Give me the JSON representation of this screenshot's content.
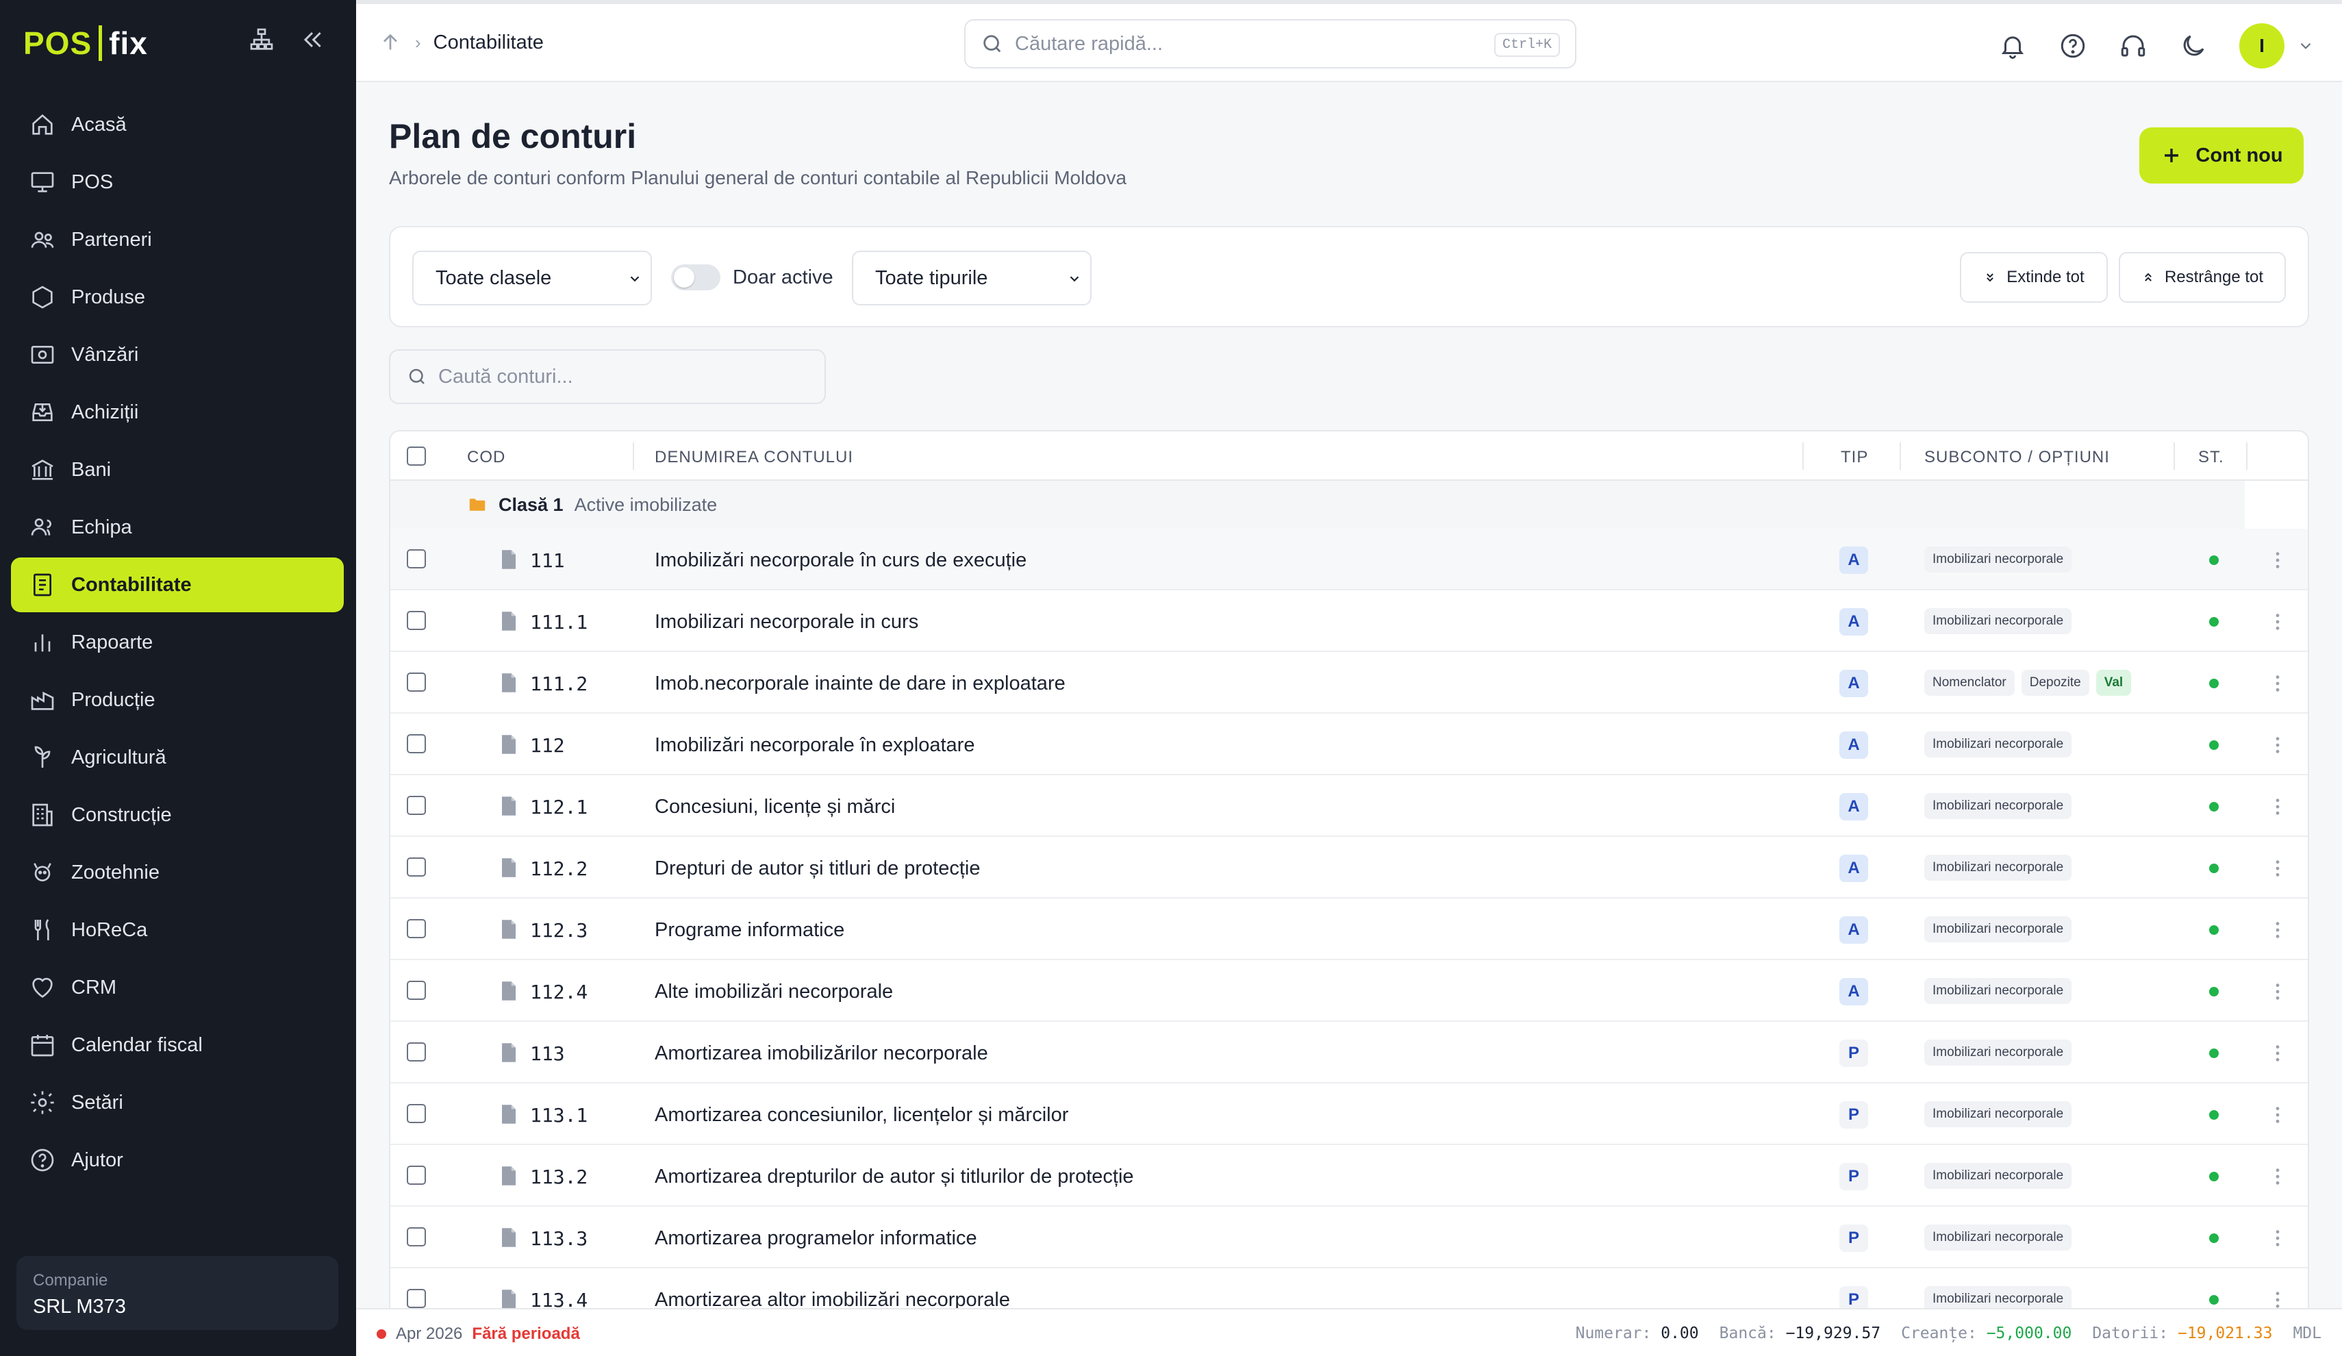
{
  "app": {
    "brand_left": "POS",
    "brand_right": "fix"
  },
  "sidebar": {
    "items": [
      {
        "label": "Acasă",
        "icon": "home-icon"
      },
      {
        "label": "POS",
        "icon": "monitor-icon"
      },
      {
        "label": "Parteneri",
        "icon": "users-icon"
      },
      {
        "label": "Produse",
        "icon": "hexagon-icon"
      },
      {
        "label": "Vânzări",
        "icon": "sales-icon"
      },
      {
        "label": "Achiziții",
        "icon": "inbox-icon"
      },
      {
        "label": "Bani",
        "icon": "bank-icon"
      },
      {
        "label": "Echipa",
        "icon": "team-icon"
      },
      {
        "label": "Contabilitate",
        "icon": "ledger-icon",
        "active": true
      },
      {
        "label": "Rapoarte",
        "icon": "bar-chart-icon"
      },
      {
        "label": "Producție",
        "icon": "factory-icon"
      },
      {
        "label": "Agricultură",
        "icon": "plant-icon"
      },
      {
        "label": "Construcție",
        "icon": "building-icon"
      },
      {
        "label": "Zootehnie",
        "icon": "animal-icon"
      },
      {
        "label": "HoReCa",
        "icon": "fork-knife-icon"
      },
      {
        "label": "CRM",
        "icon": "heart-icon"
      },
      {
        "label": "Calendar fiscal",
        "icon": "calendar-icon"
      },
      {
        "label": "Setări",
        "icon": "gear-icon"
      },
      {
        "label": "Ajutor",
        "icon": "help-icon"
      }
    ],
    "company_label": "Companie",
    "company_name": "SRL M373"
  },
  "topbar": {
    "breadcrumb": "Contabilitate",
    "search_placeholder": "Căutare rapidă...",
    "search_shortcut": "Ctrl+K",
    "avatar_initial": "I"
  },
  "page": {
    "title": "Plan de conturi",
    "subtitle": "Arborele de conturi conform Planului general de conturi contabile al Republicii Moldova",
    "new_button": "Cont nou"
  },
  "filters": {
    "class_select": "Toate clasele",
    "active_toggle_label": "Doar active",
    "type_select": "Toate tipurile",
    "expand_all": "Extinde tot",
    "collapse_all": "Restrânge tot",
    "accounts_search_placeholder": "Caută conturi..."
  },
  "table": {
    "headers": {
      "code": "COD",
      "name": "DENUMIREA CONTULUI",
      "type": "TIP",
      "subconto": "SUBCONTO / OPȚIUNI",
      "status": "ST."
    },
    "group": {
      "class": "Clasă 1",
      "name": "Active imobilizate"
    },
    "rows": [
      {
        "code": "111",
        "name": "Imobilizări necorporale în curs de execuție",
        "type": "A",
        "tags": [
          "Imobilizari necorporale"
        ]
      },
      {
        "code": "111.1",
        "name": "Imobilizari necorporale in curs",
        "type": "A",
        "tags": [
          "Imobilizari necorporale"
        ]
      },
      {
        "code": "111.2",
        "name": "Imob.necorporale inainte de dare in exploatare",
        "type": "A",
        "tags": [
          "Nomenclator",
          "Depozite",
          "Val"
        ]
      },
      {
        "code": "112",
        "name": "Imobilizări necorporale în exploatare",
        "type": "A",
        "tags": [
          "Imobilizari necorporale"
        ]
      },
      {
        "code": "112.1",
        "name": "Concesiuni, licențe și mărci",
        "type": "A",
        "tags": [
          "Imobilizari necorporale"
        ]
      },
      {
        "code": "112.2",
        "name": "Drepturi de autor și titluri de protecție",
        "type": "A",
        "tags": [
          "Imobilizari necorporale"
        ]
      },
      {
        "code": "112.3",
        "name": "Programe informatice",
        "type": "A",
        "tags": [
          "Imobilizari necorporale"
        ]
      },
      {
        "code": "112.4",
        "name": "Alte imobilizări necorporale",
        "type": "A",
        "tags": [
          "Imobilizari necorporale"
        ]
      },
      {
        "code": "113",
        "name": "Amortizarea imobilizărilor necorporale",
        "type": "P",
        "tags": [
          "Imobilizari necorporale"
        ]
      },
      {
        "code": "113.1",
        "name": "Amortizarea concesiunilor, licențelor și mărcilor",
        "type": "P",
        "tags": [
          "Imobilizari necorporale"
        ]
      },
      {
        "code": "113.2",
        "name": "Amortizarea drepturilor de autor și titlurilor de protecție",
        "type": "P",
        "tags": [
          "Imobilizari necorporale"
        ]
      },
      {
        "code": "113.3",
        "name": "Amortizarea programelor informatice",
        "type": "P",
        "tags": [
          "Imobilizari necorporale"
        ]
      },
      {
        "code": "113.4",
        "name": "Amortizarea altor imobilizări necorporale",
        "type": "P",
        "tags": [
          "Imobilizari necorporale"
        ]
      }
    ]
  },
  "footer": {
    "period": "Apr 2026",
    "period_status": "Fără perioadă",
    "cash_label": "Numerar:",
    "cash_value": "0.00",
    "bank_label": "Bancă:",
    "bank_value": "−19,929.57",
    "receivables_label": "Creanțe:",
    "receivables_value": "−5,000.00",
    "debts_label": "Datorii:",
    "debts_value": "−19,021.33",
    "currency": "MDL"
  },
  "colors": {
    "accent": "#c8ea1c",
    "sidebar_bg": "#161b24",
    "status_active": "#1fb34a"
  }
}
